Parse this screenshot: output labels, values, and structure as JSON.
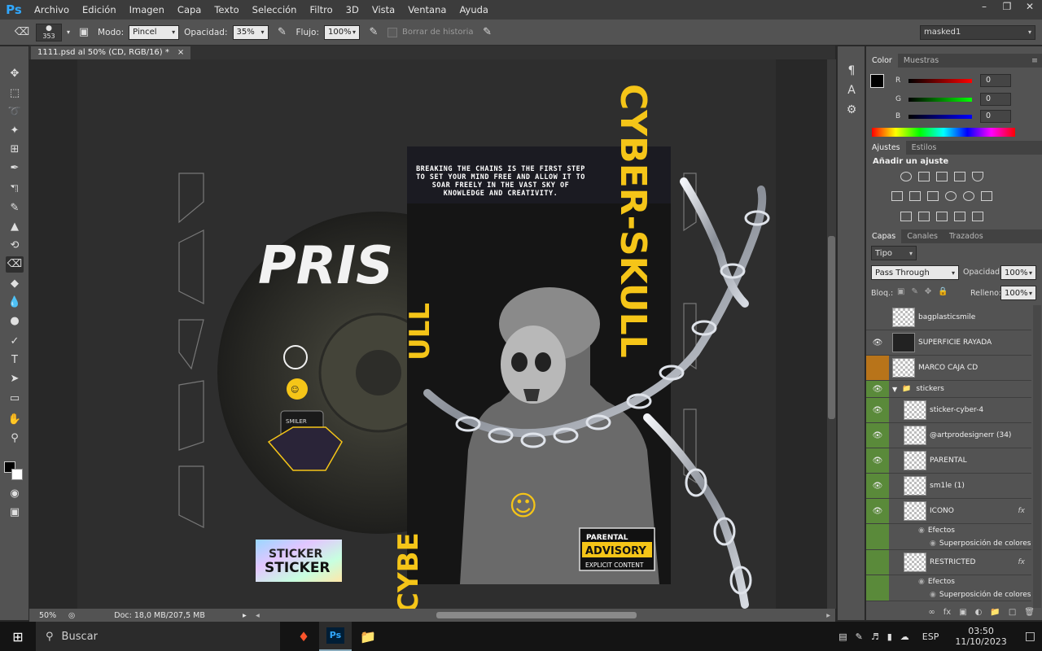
{
  "app": {
    "logo": "Ps"
  },
  "menu": [
    "Archivo",
    "Edición",
    "Imagen",
    "Capa",
    "Texto",
    "Selección",
    "Filtro",
    "3D",
    "Vista",
    "Ventana",
    "Ayuda"
  ],
  "options": {
    "brush_size": "353",
    "mode_label": "Modo:",
    "mode_value": "Pincel",
    "opacity_label": "Opacidad:",
    "opacity_value": "35%",
    "flow_label": "Flujo:",
    "flow_value": "100%",
    "erase_history_label": "Borrar de historia",
    "workspace": "masked1"
  },
  "document": {
    "tab_title": "1111.psd al 50% (CD, RGB/16) *",
    "zoom": "50%",
    "doc_info": "Doc: 18,0 MB/207,5 MB"
  },
  "artwork": {
    "quote": "BREAKING THE CHAINS IS THE FIRST STEP TO SET YOUR MIND FREE AND ALLOW IT TO SOAR FREELY IN THE VAST SKY OF KNOWLEDGE AND CREATIVITY.",
    "big_title": "CYBER-SKULL",
    "side_title": "CYBE",
    "skull_letters": "ULL",
    "cd_text": "PRIS",
    "parental": "PARENTAL",
    "advisory": "ADVISORY",
    "explicit": "EXPLICIT CONTENT",
    "sticker_top": "STICKER",
    "sticker_bottom": "STICKER",
    "smiler": "SMILER"
  },
  "color_panel": {
    "tabs": [
      "Color",
      "Muestras"
    ],
    "r_label": "R",
    "g_label": "G",
    "b_label": "B",
    "r": "0",
    "g": "0",
    "b": "0"
  },
  "adjust_panel": {
    "tabs": [
      "Ajustes",
      "Estilos"
    ],
    "title": "Añadir un ajuste"
  },
  "layers_panel": {
    "tabs": [
      "Capas",
      "Canales",
      "Trazados"
    ],
    "filter": "Tipo",
    "blend": "Pass Through",
    "opacity_label": "Opacidad:",
    "opacity": "100%",
    "lock_label": "Bloq.:",
    "fill_label": "Relleno:",
    "fill": "100%",
    "layers": [
      {
        "name": "bagplasticsmile"
      },
      {
        "name": "SUPERFICIE RAYADA"
      },
      {
        "name": "MARCO CAJA CD"
      },
      {
        "name": "stickers"
      },
      {
        "name": "sticker-cyber-4"
      },
      {
        "name": "@artprodesignerr (34)"
      },
      {
        "name": "PARENTAL"
      },
      {
        "name": "sm1le (1)"
      },
      {
        "name": "ICONO"
      },
      {
        "name": "Efectos"
      },
      {
        "name": "Superposición de colores"
      },
      {
        "name": "RESTRICTED"
      },
      {
        "name": "Efectos"
      },
      {
        "name": "Superposición de colores"
      }
    ]
  },
  "taskbar": {
    "search": "Buscar",
    "lang": "ESP",
    "time": "03:50",
    "date": "11/10/2023"
  },
  "colors": {
    "accent_yellow": "#f5c518",
    "ps_blue": "#31a8ff",
    "layer_green": "#5a8a3a",
    "layer_orange": "#b8741a"
  }
}
